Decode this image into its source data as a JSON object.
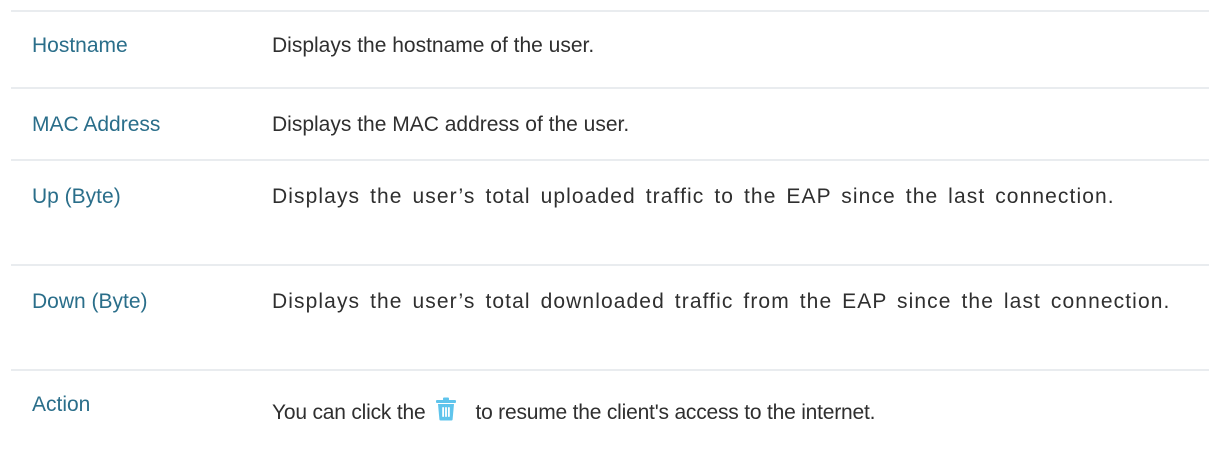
{
  "rows": [
    {
      "term": "Hostname",
      "description": "Displays the hostname of the user."
    },
    {
      "term": "MAC Address",
      "description": "Displays the MAC address of the user."
    },
    {
      "term": "Up (Byte)",
      "description": "Displays the user’s total uploaded traffic to the EAP since the last connection."
    },
    {
      "term": "Down (Byte)",
      "description": "Displays the user’s total downloaded traffic from the EAP since the last connection."
    },
    {
      "term": "Action",
      "description_before": "You can click the",
      "icon": "trash-icon",
      "description_after": "to resume the client's access to the internet."
    }
  ],
  "colors": {
    "term_text": "#2a6e8a",
    "description_text": "#2f2f2f",
    "divider": "#e9ecef",
    "trash_icon": "#5fc4ec"
  }
}
